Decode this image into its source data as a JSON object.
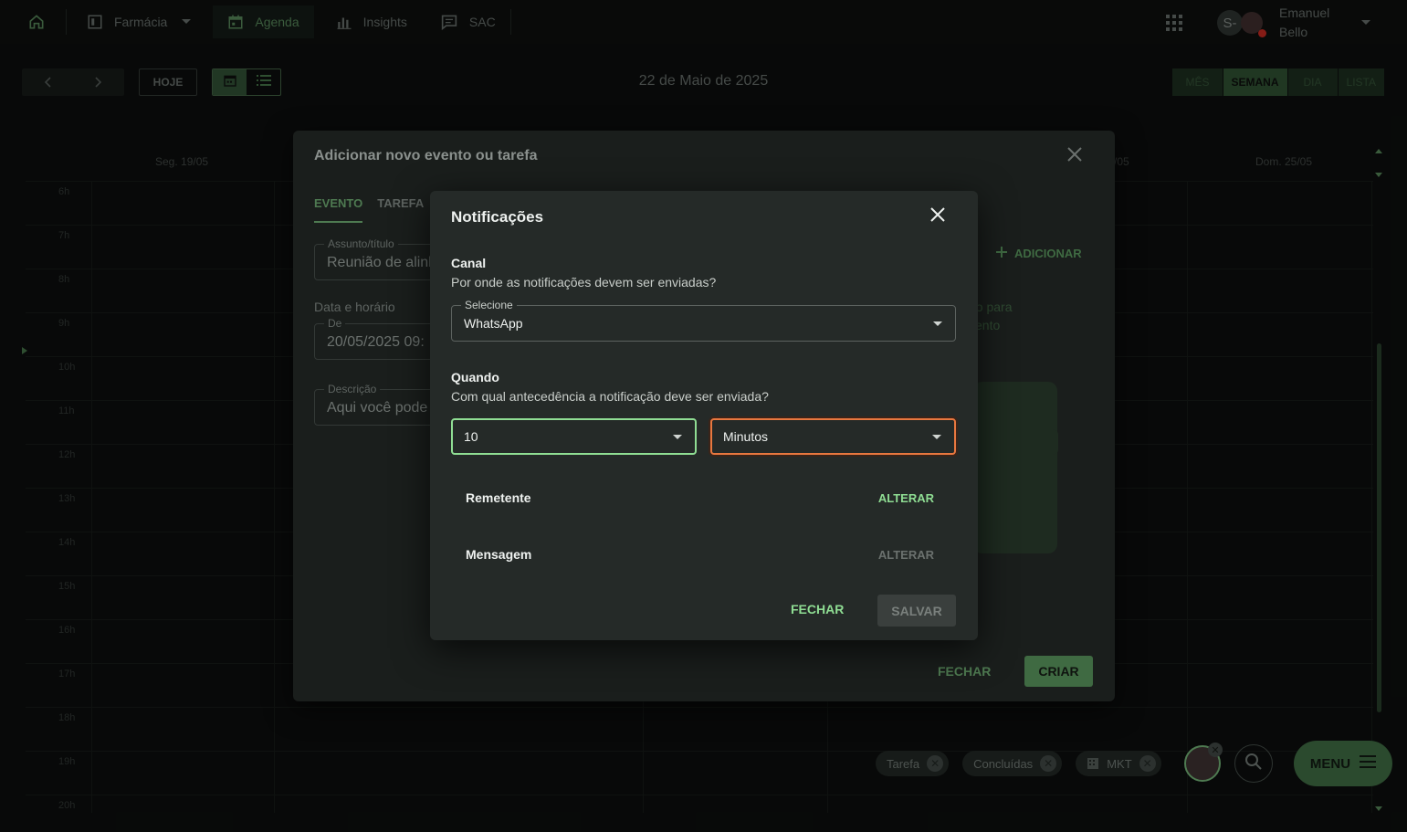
{
  "topbar": {
    "home_icon": "home-icon",
    "farmacia": "Farmácia",
    "agenda": "Agenda",
    "insights": "Insights",
    "sac": "SAC",
    "apps_icon": "grid-icon",
    "user_initial": "S-",
    "user_first": "Emanuel",
    "user_last": "Bello"
  },
  "toolbar": {
    "today": "HOJE",
    "date_title": "22 de Maio de 2025",
    "views": [
      "MÊS",
      "SEMANA",
      "DIA",
      "LISTA"
    ],
    "active_view": "SEMANA"
  },
  "calendar": {
    "day_left": "Seg. 19/05",
    "day_partial": "/05",
    "day_right": "Dom. 25/05",
    "hours": [
      "6h",
      "7h",
      "8h",
      "9h",
      "10h",
      "11h",
      "12h",
      "13h",
      "14h",
      "15h",
      "16h",
      "17h",
      "18h",
      "19h",
      "20h"
    ]
  },
  "event_dialog": {
    "title": "Adicionar novo evento ou tarefa",
    "tab_event": "EVENTO",
    "tab_task": "TAREFA",
    "subject_label": "Assunto/título",
    "subject_value": "Reunião de alinl",
    "datetime_section": "Data e horário",
    "from_label": "De",
    "from_value": "20/05/2025 09:",
    "description_label": "Descrição",
    "description_value": "Aqui você pode",
    "add_label": "ADICIONAR",
    "side_text_1": "ão para",
    "side_text_2": "vento",
    "close_label": "FECHAR",
    "create_label": "CRIAR"
  },
  "notif_dialog": {
    "title": "Notificações",
    "channel_heading": "Canal",
    "channel_question": "Por onde as notificações devem ser enviadas?",
    "channel_label": "Selecione",
    "channel_value": "WhatsApp",
    "when_heading": "Quando",
    "when_question": "Com qual antecedência a notificação deve ser enviada?",
    "amount_value": "10",
    "unit_value": "Minutos",
    "sender_label": "Remetente",
    "sender_action": "ALTERAR",
    "message_label": "Mensagem",
    "message_action": "ALTERAR",
    "close_label": "FECHAR",
    "save_label": "SALVAR"
  },
  "filters": {
    "chips": [
      "Tarefa",
      "Concluídas",
      "MKT"
    ]
  },
  "fab": {
    "menu_label": "MENU"
  },
  "colors": {
    "accent_green": "#8fdd93",
    "focus_orange": "#e8773f",
    "dialog_bg": "#252a28"
  }
}
